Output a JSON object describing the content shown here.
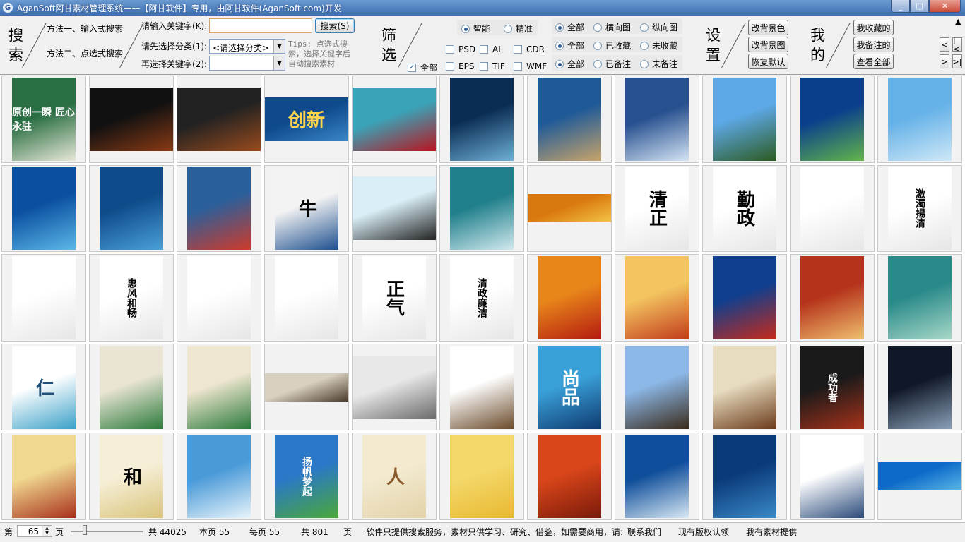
{
  "window": {
    "title": "AganSoft阿甘素材管理系统——【阿甘软件】专用，由阿甘软件(AganSoft.com)开发",
    "minimize": "_",
    "maximize": "□",
    "close": "✕"
  },
  "search": {
    "section_char1": "搜",
    "section_char2": "索",
    "method1": "方法一、输入式搜索",
    "method2": "方法二、点选式搜索",
    "keyword_label": "请输入关键字(K):",
    "keyword_value": "",
    "search_button": "搜索(S)",
    "category_label": "请先选择分类(1):",
    "category_value": "<请选择分类>",
    "keyword2_label": "再选择关键字(2):",
    "keyword2_value": "",
    "tips": "Tips: 点选式搜索，选择关键字后自动搜索素材"
  },
  "filter": {
    "section_char1": "筛",
    "section_char2": "选",
    "match_smart": "智能",
    "match_exact": "精准",
    "all_label": "全部",
    "formats": [
      "PSD",
      "AI",
      "CDR",
      "EPS",
      "TIF",
      "WMF"
    ],
    "orient_all": "全部",
    "orient_h": "横向图",
    "orient_v": "纵向图",
    "fav_all": "全部",
    "fav_yes": "已收藏",
    "fav_no": "未收藏",
    "note_all": "全部",
    "note_yes": "已备注",
    "note_no": "未备注"
  },
  "settings": {
    "section_char1": "设",
    "section_char2": "置",
    "bg_color": "改背景色",
    "bg_image": "改背景图",
    "reset": "恢复默认"
  },
  "mine": {
    "section_char1": "我",
    "section_char2": "的",
    "favorites": "我收藏的",
    "notes": "我备注的",
    "view_all": "查看全部"
  },
  "nav": {
    "prev": "<",
    "first": "|<",
    "next": ">",
    "last": ">|"
  },
  "thumbnails": [
    {
      "shape": "p",
      "c1": "#2a6e44",
      "c2": "#e8e8d8",
      "text": "原创一瞬 匠心永驻",
      "color": "#fff"
    },
    {
      "shape": "sq",
      "c1": "#111111",
      "c2": "#8b3a14",
      "text": "",
      "color": "#fff"
    },
    {
      "shape": "sq",
      "c1": "#222222",
      "c2": "#9a4b1c",
      "text": "",
      "color": "#fff"
    },
    {
      "shape": "l",
      "c1": "#0e4a8c",
      "c2": "#3a86c8",
      "text": "创新",
      "color": "#ffd34d"
    },
    {
      "shape": "sq",
      "c1": "#3aa3b8",
      "c2": "#b8141e",
      "text": "",
      "color": "#fff"
    },
    {
      "shape": "p",
      "c1": "#0b2d54",
      "c2": "#6fb0d6",
      "text": "",
      "color": "#fff"
    },
    {
      "shape": "p",
      "c1": "#1f5a98",
      "c2": "#c9a46a",
      "text": "",
      "color": "#fff"
    },
    {
      "shape": "p",
      "c1": "#27508f",
      "c2": "#d4e4f4",
      "text": "",
      "color": "#fff"
    },
    {
      "shape": "p",
      "c1": "#5da8e6",
      "c2": "#2c5a20",
      "text": "",
      "color": "#fff"
    },
    {
      "shape": "p",
      "c1": "#0a3f8c",
      "c2": "#62b54a",
      "text": "",
      "color": "#fff"
    },
    {
      "shape": "p",
      "c1": "#66b2e8",
      "c2": "#cfe8f7",
      "text": "",
      "color": "#fff"
    },
    {
      "shape": "p",
      "c1": "#0a4fa0",
      "c2": "#5cb8e8",
      "text": "",
      "color": "#ffd34d"
    },
    {
      "shape": "p",
      "c1": "#0e4b8a",
      "c2": "#4aa0d8",
      "text": "",
      "color": "#fff"
    },
    {
      "shape": "p",
      "c1": "#2b5f9a",
      "c2": "#cf3a2a",
      "text": "",
      "color": "#fff"
    },
    {
      "shape": "p",
      "c1": "#f3f3f3",
      "c2": "#1d4f8e",
      "text": "牛",
      "color": "#000"
    },
    {
      "shape": "sq",
      "c1": "#d9eef6",
      "c2": "#222222",
      "text": "",
      "color": "#fff"
    },
    {
      "shape": "p",
      "c1": "#1f7f8a",
      "c2": "#d2e9ef",
      "text": "",
      "color": "#fff"
    },
    {
      "shape": "w",
      "c1": "#d9780e",
      "c2": "#f4c447",
      "text": "",
      "color": "#fff"
    },
    {
      "shape": "p",
      "c1": "#ffffff",
      "c2": "#e6e6e6",
      "text": "清正",
      "color": "#000"
    },
    {
      "shape": "p",
      "c1": "#ffffff",
      "c2": "#e6e6e6",
      "text": "勤政",
      "color": "#000"
    },
    {
      "shape": "p",
      "c1": "#ffffff",
      "c2": "#e6e6e6",
      "text": "",
      "color": "#000"
    },
    {
      "shape": "p",
      "c1": "#ffffff",
      "c2": "#e6e6e6",
      "text": "激濁揚清",
      "color": "#000"
    },
    {
      "shape": "p",
      "c1": "#ffffff",
      "c2": "#e6e6e6",
      "text": "",
      "color": "#000"
    },
    {
      "shape": "p",
      "c1": "#ffffff",
      "c2": "#e6e6e6",
      "text": "惠风和畅",
      "color": "#000"
    },
    {
      "shape": "p",
      "c1": "#ffffff",
      "c2": "#e6e6e6",
      "text": "",
      "color": "#000"
    },
    {
      "shape": "p",
      "c1": "#ffffff",
      "c2": "#e6e6e6",
      "text": "",
      "color": "#000"
    },
    {
      "shape": "p",
      "c1": "#ffffff",
      "c2": "#e6e6e6",
      "text": "正气",
      "color": "#000"
    },
    {
      "shape": "p",
      "c1": "#ffffff",
      "c2": "#e6e6e6",
      "text": "清政廉洁",
      "color": "#000"
    },
    {
      "shape": "p",
      "c1": "#e8861a",
      "c2": "#b31a10",
      "text": "",
      "color": "#fff"
    },
    {
      "shape": "p",
      "c1": "#f3c460",
      "c2": "#c23a1a",
      "text": "",
      "color": "#b31a10"
    },
    {
      "shape": "p",
      "c1": "#0f3f8e",
      "c2": "#c82a1a",
      "text": "",
      "color": "#fff"
    },
    {
      "shape": "p",
      "c1": "#b5331a",
      "c2": "#f0c070",
      "text": "",
      "color": "#fff"
    },
    {
      "shape": "p",
      "c1": "#2a8a8a",
      "c2": "#a8d8c8",
      "text": "",
      "color": "#fff"
    },
    {
      "shape": "p",
      "c1": "#ffffff",
      "c2": "#3aa0c8",
      "text": "仁",
      "color": "#1f4f7a"
    },
    {
      "shape": "p",
      "c1": "#e9e4d4",
      "c2": "#2a7a3a",
      "text": "",
      "color": "#000"
    },
    {
      "shape": "p",
      "c1": "#efe6d0",
      "c2": "#2a7a3a",
      "text": "",
      "color": "#000"
    },
    {
      "shape": "w",
      "c1": "#d8d0c0",
      "c2": "#4a3a2a",
      "text": "",
      "color": "#000"
    },
    {
      "shape": "sq",
      "c1": "#e8e8e8",
      "c2": "#6a6a6a",
      "text": "",
      "color": "#000"
    },
    {
      "shape": "p",
      "c1": "#ffffff",
      "c2": "#6a4a2a",
      "text": "",
      "color": "#000"
    },
    {
      "shape": "p",
      "c1": "#3aa0d8",
      "c2": "#0e3a70",
      "text": "尚品",
      "color": "#fff"
    },
    {
      "shape": "p",
      "c1": "#8cb8e8",
      "c2": "#3a2a1a",
      "text": "",
      "color": "#fff"
    },
    {
      "shape": "p",
      "c1": "#e8dcc0",
      "c2": "#6a3a1a",
      "text": "",
      "color": "#b31a10"
    },
    {
      "shape": "p",
      "c1": "#1a1a1a",
      "c2": "#a8321a",
      "text": "成功者",
      "color": "#fff"
    },
    {
      "shape": "p",
      "c1": "#101828",
      "c2": "#8aa0b8",
      "text": "",
      "color": "#fff"
    },
    {
      "shape": "p",
      "c1": "#f0d890",
      "c2": "#a8301a",
      "text": "",
      "color": "#000"
    },
    {
      "shape": "p",
      "c1": "#f6efd8",
      "c2": "#d9c47a",
      "text": "和",
      "color": "#000"
    },
    {
      "shape": "p",
      "c1": "#4a9ad8",
      "c2": "#e8f4fb",
      "text": "",
      "color": "#fff"
    },
    {
      "shape": "p",
      "c1": "#2a78c8",
      "c2": "#4aa838",
      "text": "扬帆梦起",
      "color": "#fff"
    },
    {
      "shape": "p",
      "c1": "#f3ead0",
      "c2": "#e2d2a8",
      "text": "人",
      "color": "#8a5a2a"
    },
    {
      "shape": "p",
      "c1": "#f4d86a",
      "c2": "#e8b830",
      "text": "",
      "color": "#b31a10"
    },
    {
      "shape": "p",
      "c1": "#d9461a",
      "c2": "#7a1a0a",
      "text": "",
      "color": "#f4d86a"
    },
    {
      "shape": "p",
      "c1": "#0f4e9a",
      "c2": "#d8e8f4",
      "text": "",
      "color": "#fff"
    },
    {
      "shape": "p",
      "c1": "#0b3a7a",
      "c2": "#3a8ac8",
      "text": "",
      "color": "#fff"
    },
    {
      "shape": "p",
      "c1": "#ffffff",
      "c2": "#2a4a7a",
      "text": "",
      "color": "#000"
    },
    {
      "shape": "w",
      "c1": "#0e6ac8",
      "c2": "#5ab8e8",
      "text": "",
      "color": "#fff"
    }
  ],
  "status": {
    "page_prefix": "第",
    "page_value": "65",
    "page_suffix": "页",
    "total_items": "共 44025",
    "this_page": "本页 55",
    "per_page": "每页 55",
    "total_pages": "共 801",
    "pages_unit": "页",
    "notice": "软件只提供搜索服务，素材只供学习、研究、借鉴，如需要商用，请:",
    "contact": "联系我们",
    "copyright": "现有版权认领",
    "provide": "我有素材提供"
  }
}
